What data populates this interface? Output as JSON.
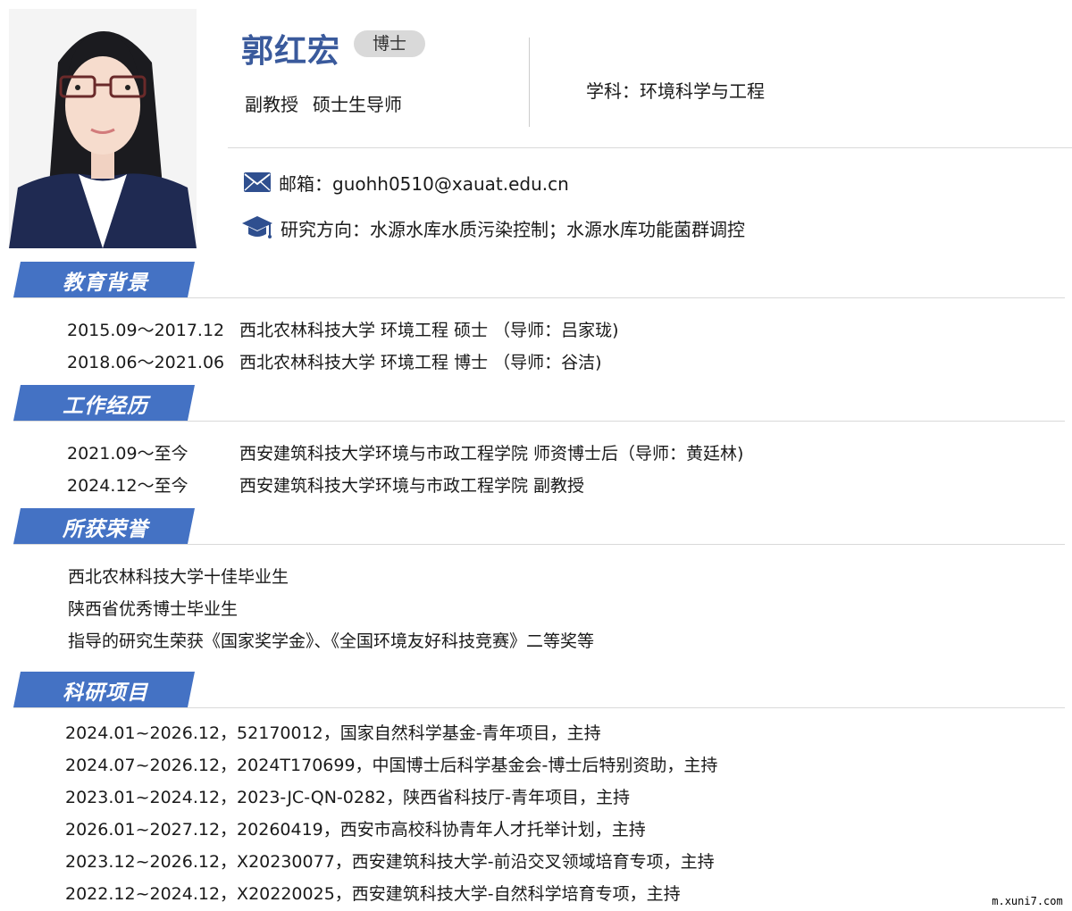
{
  "profile": {
    "name": "郭红宏",
    "degree": "博士",
    "title": "副教授",
    "supervisor_role": "硕士生导师",
    "subject": "学科：环境科学与工程",
    "email": "邮箱：guohh0510@xauat.edu.cn",
    "research": "研究方向：水源水库水质污染控制；水源水库功能菌群调控"
  },
  "colors": {
    "accent": "#3a5a9c",
    "banner": "#4472c4",
    "badge": "#d9d9d9"
  },
  "icons": {
    "email": "envelope-icon",
    "research": "graduation-cap-icon"
  },
  "sections": {
    "education": {
      "label": "教育背景",
      "items": [
        {
          "date": "2015.09～2017.12",
          "text": "西北农林科技大学 环境工程 硕士 （导师：吕家珑)"
        },
        {
          "date": "2018.06～2021.06",
          "text": "西北农林科技大学 环境工程 博士 （导师：谷洁)"
        }
      ]
    },
    "work": {
      "label": "工作经历",
      "items": [
        {
          "date": "2021.09～至今",
          "text": "西安建筑科技大学环境与市政工程学院  师资博士后（导师：黄廷林)"
        },
        {
          "date": "2024.12～至今",
          "text": "西安建筑科技大学环境与市政工程学院  副教授"
        }
      ]
    },
    "honors": {
      "label": "所获荣誉",
      "items": [
        "西北农林科技大学十佳毕业生",
        "陕西省优秀博士毕业生",
        "指导的研究生荣获《国家奖学金》、《全国环境友好科技竞赛》二等奖等"
      ]
    },
    "projects": {
      "label": "科研项目",
      "items": [
        "2024.01~2026.12，52170012，国家自然科学基金-青年项目，主持",
        "2024.07~2026.12，2024T170699，中国博士后科学基金会-博士后特别资助，主持",
        "2023.01~2024.12，2023-JC-QN-0282，陕西省科技厅-青年项目，主持",
        "2026.01~2027.12，20260419，西安市高校科协青年人才托举计划，主持",
        "2023.12~2026.12，X20230077，西安建筑科技大学-前沿交叉领域培育专项，主持",
        "2022.12~2024.12，X20220025，西安建筑科技大学-自然科学培育专项，主持"
      ]
    }
  },
  "watermark": "m.xuni7.com"
}
